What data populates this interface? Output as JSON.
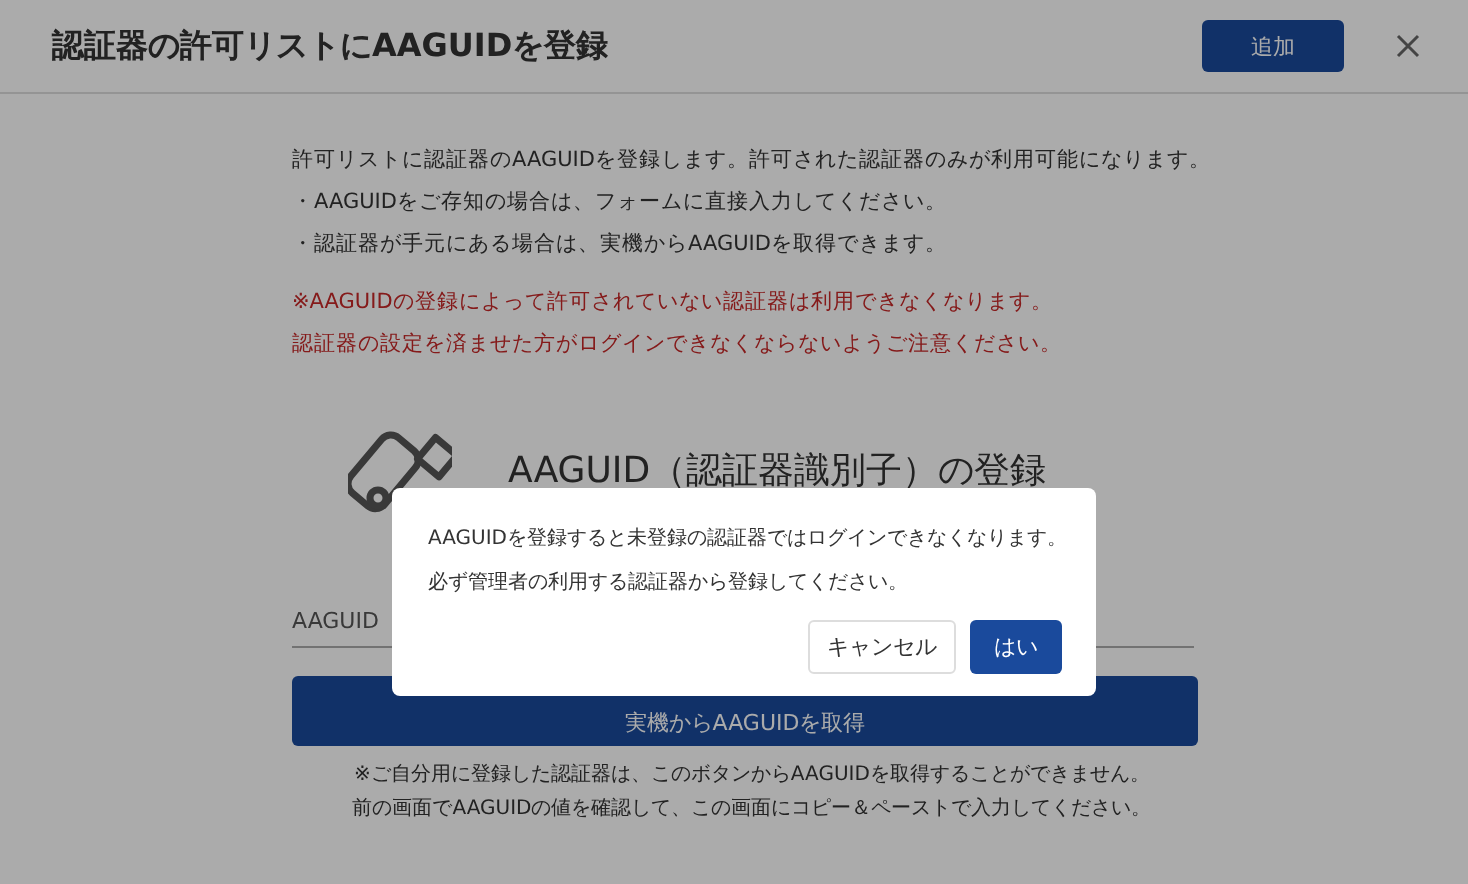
{
  "dialog": {
    "title": "認証器の許可リストにAAGUIDを登録",
    "add_button": "追加",
    "intro": "許可リストに認証器のAAGUIDを登録します。許可された認証器のみが利用可能になります。",
    "bullets": [
      "・AAGUIDをご存知の場合は、フォームに直接入力してください。",
      "・認証器が手元にある場合は、実機からAAGUIDを取得できます。"
    ],
    "warnings": [
      "※AAGUIDの登録によって許可されていない認証器は利用できなくなります。",
      "認証器の設定を済ませた方がログインできなくならないようご注意ください。"
    ],
    "section_heading": "AAGUID（認証器識別子）の登録",
    "field_label": "AAGUID",
    "fetch_button": "実機からAAGUIDを取得",
    "notes": [
      "※ご自分用に登録した認証器は、このボタンからAAGUIDを取得することができません。",
      "前の画面でAAGUIDの値を確認して、この画面にコピー＆ペーストで入力してください。"
    ]
  },
  "confirm": {
    "lines": [
      "AAGUIDを登録すると未登録の認証器ではログインできなくなります。",
      "必ず管理者の利用する認証器から登録してください。"
    ],
    "buttons": [
      {
        "label": "キャンセル",
        "kind": "secondary"
      },
      {
        "label": "はい",
        "kind": "primary"
      }
    ]
  }
}
